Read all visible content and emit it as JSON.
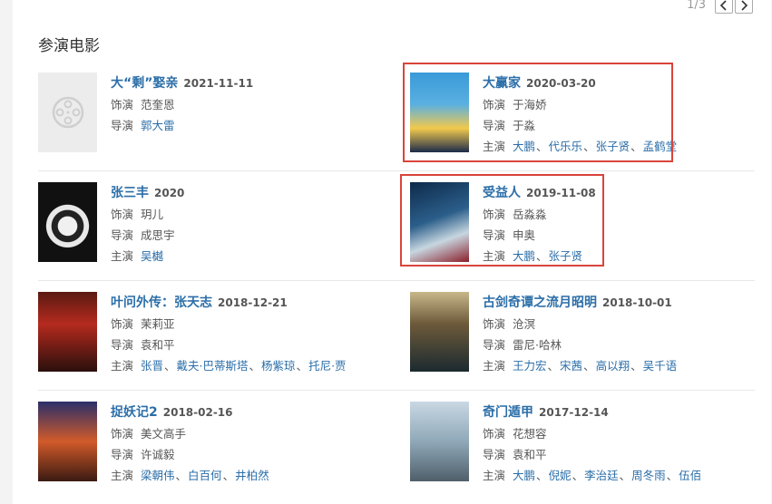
{
  "pager": {
    "text": "1/3"
  },
  "section_title": "参演电影",
  "labels": {
    "role": "饰演",
    "director": "导演",
    "star": "主演"
  },
  "movies": [
    {
      "title": "大“剩”娶亲",
      "date": "2021-11-11",
      "role": "范奎恩",
      "director": [
        "郭大雷"
      ],
      "stars": []
    },
    {
      "title": "大赢家",
      "date": "2020-03-20",
      "role": "于海娇",
      "director": [
        "于淼"
      ],
      "director_plain": true,
      "stars": [
        "大鹏",
        "代乐乐",
        "张子贤",
        "孟鹤堂"
      ]
    },
    {
      "title": "张三丰",
      "date": "2020",
      "role": "玥儿",
      "director": [
        "成思宇"
      ],
      "director_plain": true,
      "stars": [
        "吴樾"
      ]
    },
    {
      "title": "受益人",
      "date": "2019-11-08",
      "role": "岳淼淼",
      "director": [
        "申奥"
      ],
      "director_plain": true,
      "stars": [
        "大鹏",
        "张子贤"
      ]
    },
    {
      "title": "叶问外传：张天志",
      "date": "2018-12-21",
      "role": "茉莉亚",
      "director": [
        "袁和平"
      ],
      "director_plain": true,
      "stars": [
        "张晋",
        "戴夫·巴蒂斯塔",
        "杨紫琼",
        "托尼·贾"
      ]
    },
    {
      "title": "古剑奇谭之流月昭明",
      "date": "2018-10-01",
      "role": "沧溟",
      "director": [
        "雷尼·哈林"
      ],
      "director_plain": true,
      "stars": [
        "王力宏",
        "宋茜",
        "高以翔",
        "吴千语"
      ]
    },
    {
      "title": "捉妖记2",
      "date": "2018-02-16",
      "role": "美文高手",
      "director": [
        "许诚毅"
      ],
      "director_plain": true,
      "stars": [
        "梁朝伟",
        "白百何",
        "井柏然"
      ]
    },
    {
      "title": "奇门遁甲",
      "date": "2017-12-14",
      "role": "花想容",
      "director": [
        "袁和平"
      ],
      "director_plain": true,
      "stars": [
        "大鹏",
        "倪妮",
        "李治廷",
        "周冬雨",
        "伍佰"
      ]
    }
  ],
  "colors": {
    "link": "#2b6ea8",
    "highlight": "#d9443b"
  }
}
